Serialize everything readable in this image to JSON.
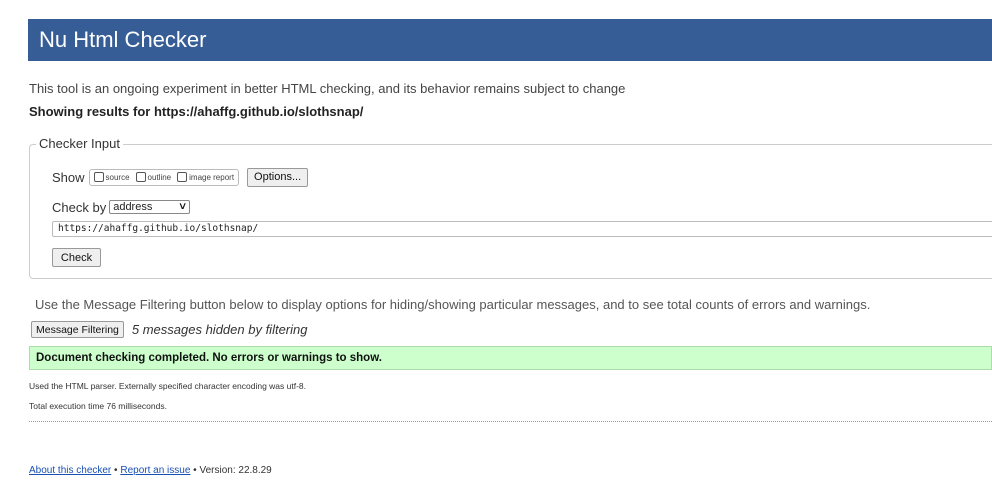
{
  "header": {
    "title": "Nu Html Checker"
  },
  "intro": "This tool is an ongoing experiment in better HTML checking, and its behavior remains subject to change",
  "showing_results": "Showing results for https://ahaffg.github.io/slothsnap/",
  "checker_input": {
    "legend": "Checker Input",
    "show_label": "Show",
    "show_options": [
      {
        "label": "source",
        "checked": false
      },
      {
        "label": "outline",
        "checked": false
      },
      {
        "label": "image report",
        "checked": false
      }
    ],
    "options_button": "Options...",
    "check_by_label": "Check by",
    "check_by_value": "address",
    "address_value": "https://ahaffg.github.io/slothsnap/",
    "check_button": "Check"
  },
  "filter": {
    "note": "Use the Message Filtering button below to display options for hiding/showing particular messages, and to see total counts of errors and warnings.",
    "button": "Message Filtering",
    "hidden_count_text": "5 messages hidden by filtering"
  },
  "result": {
    "success_message": "Document checking completed. No errors or warnings to show.",
    "parser_info": "Used the HTML parser. Externally specified character encoding was utf-8.",
    "execution_time": "Total execution time 76 milliseconds."
  },
  "footer": {
    "about_link": "About this checker",
    "separator": "•",
    "report_link": "Report an issue",
    "version": "Version: 22.8.29"
  },
  "colors": {
    "header_bg": "#365d95",
    "success_bg": "#ccffcc",
    "link": "#1a4fb3"
  }
}
